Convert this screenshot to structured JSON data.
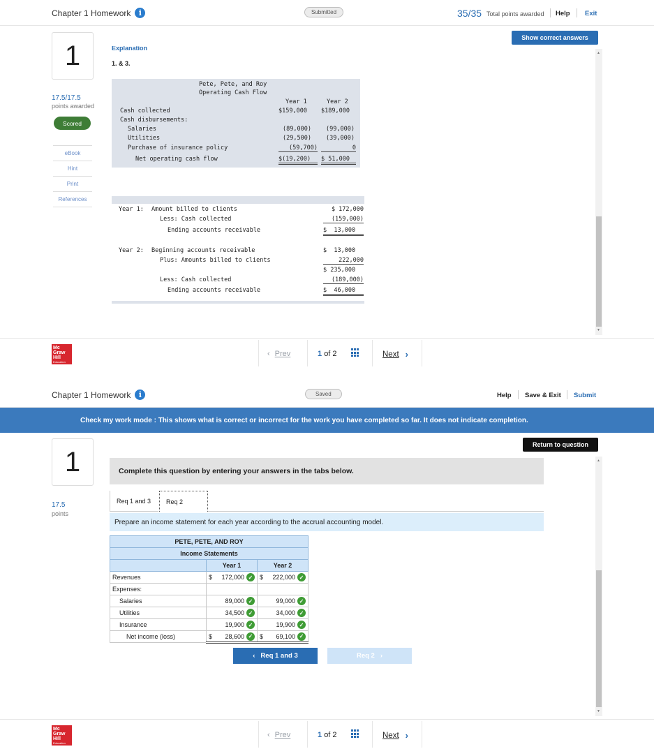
{
  "top": {
    "header": {
      "title": "Chapter 1 Homework",
      "status": "Submitted",
      "score": "35/35",
      "score_label": "Total points awarded",
      "help": "Help",
      "exit": "Exit"
    },
    "question_number": "1",
    "points": "17.5/17.5",
    "points_label": "points awarded",
    "scored": "Scored",
    "rail_links": [
      "eBook",
      "Hint",
      "Print",
      "References"
    ],
    "show_answers": "Show correct answers",
    "explanation_heading": "Explanation",
    "explanation_num": "1. & 3.",
    "cash_flow": {
      "title1": "Pete, Pete, and Roy",
      "title2": "Operating Cash Flow",
      "col1": "Year 1",
      "col2": "Year 2",
      "rows": [
        {
          "label": "Cash collected",
          "y1": "$159,000",
          "y2": "$189,000"
        },
        {
          "label": "Cash disbursements:",
          "y1": "",
          "y2": ""
        },
        {
          "label": "Salaries",
          "y1": "(89,000)",
          "y2": "(99,000)"
        },
        {
          "label": "Utilities",
          "y1": "(29,500)",
          "y2": "(39,000)"
        },
        {
          "label": "Purchase of insurance policy",
          "y1": "(59,700)",
          "y2": "0"
        },
        {
          "label": "Net operating cash flow",
          "y1": "$(19,200)",
          "y2": "$ 51,000"
        }
      ]
    },
    "receivables": {
      "y1_label": "Year 1:",
      "y1_rows": [
        {
          "label": "Amount billed to clients",
          "value": "$ 172,000"
        },
        {
          "label": "Less: Cash collected",
          "value": "(159,000)"
        },
        {
          "label": "Ending accounts receivable",
          "value": "$  13,000"
        }
      ],
      "y2_label": "Year 2:",
      "y2_rows": [
        {
          "label": "Beginning accounts receivable",
          "value": "$  13,000"
        },
        {
          "label": "Plus: Amounts billed to clients",
          "value": "222,000"
        },
        {
          "label": "",
          "value": "$ 235,000"
        },
        {
          "label": "Less: Cash collected",
          "value": "(189,000)"
        },
        {
          "label": "Ending accounts receivable",
          "value": "$  46,000"
        }
      ]
    },
    "footer": {
      "prev": "Prev",
      "page_current": "1",
      "page_of": "of 2",
      "next": "Next"
    }
  },
  "bottom": {
    "header": {
      "title": "Chapter 1 Homework",
      "status": "Saved",
      "help": "Help",
      "save_exit": "Save & Exit",
      "submit": "Submit"
    },
    "banner": "Check my work mode : This shows what is correct or incorrect for the work you have completed so far. It does not indicate completion.",
    "return": "Return to question",
    "question_number": "1",
    "points": "17.5",
    "points_label": "points",
    "complete_text": "Complete this question by entering your answers in the tabs below.",
    "tabs": [
      "Req 1 and 3",
      "Req 2"
    ],
    "prepare": "Prepare an income statement for each year according to the accrual accounting model.",
    "income": {
      "company": "PETE, PETE, AND ROY",
      "title": "Income Statements",
      "col1": "Year 1",
      "col2": "Year 2",
      "revenues": {
        "label": "Revenues",
        "y1": "172,000",
        "y2": "222,000"
      },
      "expenses_label": "Expenses:",
      "expenses": [
        {
          "label": "Salaries",
          "y1": "89,000",
          "y2": "99,000"
        },
        {
          "label": "Utilities",
          "y1": "34,500",
          "y2": "34,000"
        },
        {
          "label": "Insurance",
          "y1": "19,900",
          "y2": "19,900"
        }
      ],
      "net": {
        "label": "Net income (loss)",
        "y1": "28,600",
        "y2": "69,100"
      },
      "dollar": "$"
    },
    "btn_prev": "Req 1 and 3",
    "btn_next": "Req 2",
    "footer": {
      "prev": "Prev",
      "page_current": "1",
      "page_of": "of 2",
      "next": "Next"
    }
  },
  "logo": {
    "line1": "Mc",
    "line2": "Graw",
    "line3": "Hill",
    "line4": "Education"
  },
  "colors": {
    "accent": "#2a6db3",
    "banner": "#3b7abd",
    "correct": "#3f9c35",
    "scored": "#3e7d36",
    "logo": "#d7262e"
  }
}
